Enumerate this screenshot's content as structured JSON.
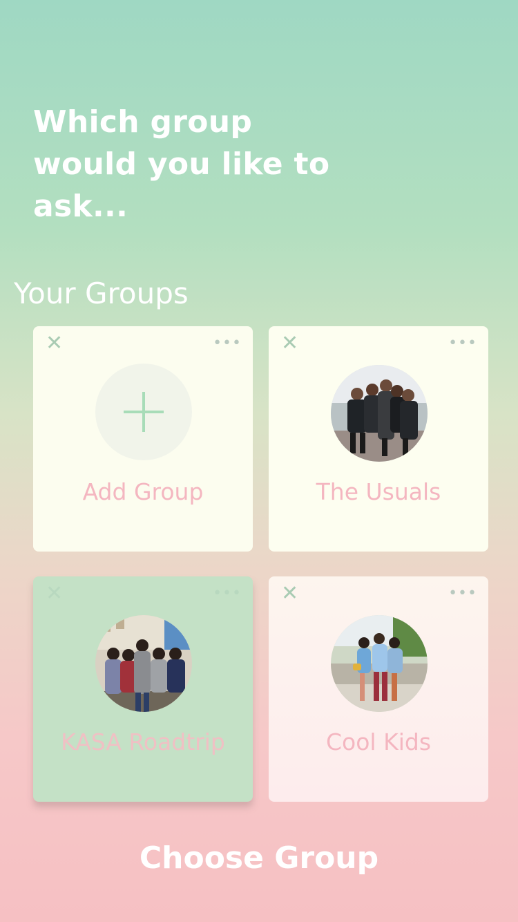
{
  "headline": "Which group\nwould you like to\nask...",
  "section_title": "Your Groups",
  "icons": {
    "close": "close-icon",
    "more": "more-dots-icon",
    "add": "plus-icon"
  },
  "groups": [
    {
      "label": "Add Group",
      "type": "add"
    },
    {
      "label": "The Usuals",
      "type": "group"
    },
    {
      "label": "KASA Roadtrip",
      "type": "group",
      "selected": true
    },
    {
      "label": "Cool Kids",
      "type": "group"
    }
  ],
  "close_glyph": "✕",
  "more_glyph": "•••",
  "action_button": "Choose Group",
  "colors": {
    "label_pink": "#f4b6c0",
    "selected_card": "#c4e1c6",
    "card_bg": "#fcfdf0",
    "plus_green": "#a8dcb8"
  }
}
